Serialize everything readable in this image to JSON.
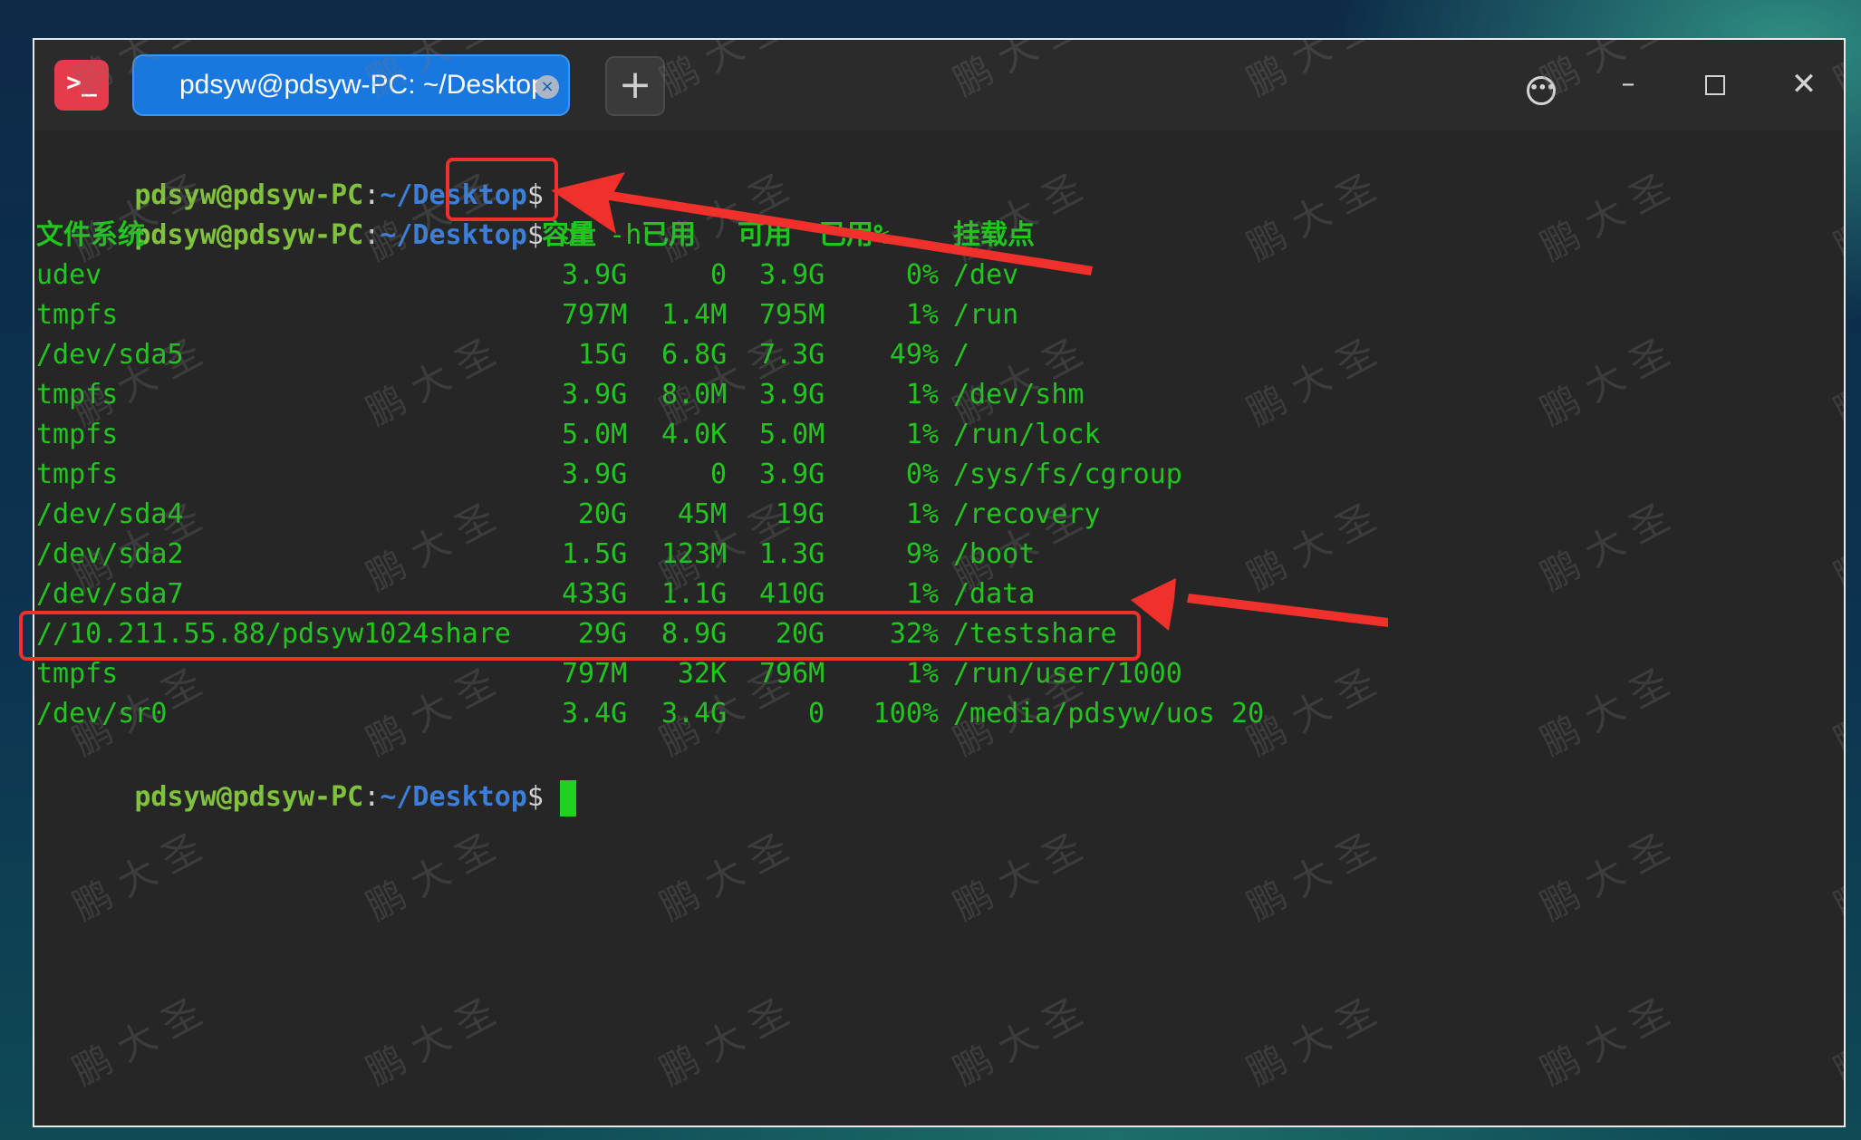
{
  "window": {
    "app_icon": ">_",
    "tab_title": "pdsyw@pdsyw-PC: ~/Desktop",
    "tab_close": "×",
    "new_tab": "+",
    "menu_icon": "•••",
    "minimize": "–",
    "close": "✕"
  },
  "prompt": {
    "user_host": "pdsyw@pdsyw-PC",
    "colon": ":",
    "path": "~/Desktop",
    "dollar": "$"
  },
  "command": "df -h",
  "df": {
    "headers": {
      "filesystem": "文件系统",
      "size": "容量",
      "used": "已用",
      "avail": "可用",
      "use_pct": "已用%",
      "mounted_on": "挂载点"
    },
    "rows": [
      {
        "filesystem": "udev",
        "size": "3.9G",
        "used": "0",
        "avail": "3.9G",
        "use_pct": "0%",
        "mounted_on": "/dev"
      },
      {
        "filesystem": "tmpfs",
        "size": "797M",
        "used": "1.4M",
        "avail": "795M",
        "use_pct": "1%",
        "mounted_on": "/run"
      },
      {
        "filesystem": "/dev/sda5",
        "size": "15G",
        "used": "6.8G",
        "avail": "7.3G",
        "use_pct": "49%",
        "mounted_on": "/"
      },
      {
        "filesystem": "tmpfs",
        "size": "3.9G",
        "used": "8.0M",
        "avail": "3.9G",
        "use_pct": "1%",
        "mounted_on": "/dev/shm"
      },
      {
        "filesystem": "tmpfs",
        "size": "5.0M",
        "used": "4.0K",
        "avail": "5.0M",
        "use_pct": "1%",
        "mounted_on": "/run/lock"
      },
      {
        "filesystem": "tmpfs",
        "size": "3.9G",
        "used": "0",
        "avail": "3.9G",
        "use_pct": "0%",
        "mounted_on": "/sys/fs/cgroup"
      },
      {
        "filesystem": "/dev/sda4",
        "size": "20G",
        "used": "45M",
        "avail": "19G",
        "use_pct": "1%",
        "mounted_on": "/recovery"
      },
      {
        "filesystem": "/dev/sda2",
        "size": "1.5G",
        "used": "123M",
        "avail": "1.3G",
        "use_pct": "9%",
        "mounted_on": "/boot"
      },
      {
        "filesystem": "/dev/sda7",
        "size": "433G",
        "used": "1.1G",
        "avail": "410G",
        "use_pct": "1%",
        "mounted_on": "/data"
      },
      {
        "filesystem": "//10.211.55.88/pdsyw1024share",
        "size": "29G",
        "used": "8.9G",
        "avail": "20G",
        "use_pct": "32%",
        "mounted_on": "/testshare"
      },
      {
        "filesystem": "tmpfs",
        "size": "797M",
        "used": "32K",
        "avail": "796M",
        "use_pct": "1%",
        "mounted_on": "/run/user/1000"
      },
      {
        "filesystem": "/dev/sr0",
        "size": "3.4G",
        "used": "3.4G",
        "avail": "0",
        "use_pct": "100%",
        "mounted_on": "/media/pdsyw/uos 20"
      }
    ]
  },
  "watermark": "鹏 大 圣",
  "colors": {
    "terminal_bg": "#262626",
    "output_text": "#22c51f",
    "prompt_user": "#80c23d",
    "prompt_path": "#3b7fd9",
    "tab_active": "#1978e0",
    "annotation": "#f0302a"
  }
}
